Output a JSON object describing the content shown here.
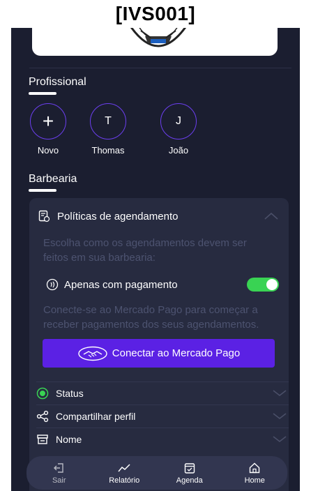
{
  "watermark": "[IVS001]",
  "profissional": {
    "title": "Profissional",
    "items": [
      {
        "initial": "+",
        "name": "Novo"
      },
      {
        "initial": "T",
        "name": "Thomas"
      },
      {
        "initial": "J",
        "name": "João"
      }
    ]
  },
  "barbearia": {
    "title": "Barbearia",
    "politicas": {
      "title": "Políticas de agendamento",
      "description": "Escolha como os agendamentos devem ser feitos em sua barbearia:",
      "toggle_label": "Apenas com pagamento",
      "toggle_on": true,
      "mp_text": "Conecte-se ao Mercado Pago para começar a receber pagamentos dos seus agendamentos.",
      "connect_button": "Conectar ao Mercado Pago"
    },
    "rows": [
      {
        "icon": "status-icon",
        "label": "Status"
      },
      {
        "icon": "share-icon",
        "label": "Compartilhar perfil"
      },
      {
        "icon": "store-icon",
        "label": "Nome"
      }
    ]
  },
  "nav": [
    {
      "icon": "logout-icon",
      "label": "Sair"
    },
    {
      "icon": "chart-icon",
      "label": "Relatório"
    },
    {
      "icon": "calendar-icon",
      "label": "Agenda"
    },
    {
      "icon": "home-icon",
      "label": "Home"
    }
  ],
  "colors": {
    "background": "#1b1e30",
    "panel": "#272b40",
    "accent": "#5b21e4",
    "toggle": "#39d353",
    "status": "#39d353"
  }
}
